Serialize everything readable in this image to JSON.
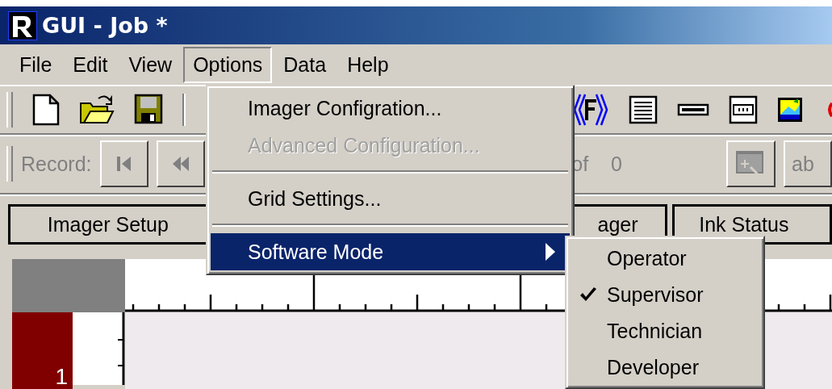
{
  "window": {
    "title": "GUI - Job *"
  },
  "menu_bar": [
    {
      "label": "File",
      "selected": false
    },
    {
      "label": "Edit",
      "selected": false
    },
    {
      "label": "View",
      "selected": false
    },
    {
      "label": "Options",
      "selected": true
    },
    {
      "label": "Data",
      "selected": false
    },
    {
      "label": "Help",
      "selected": false
    }
  ],
  "options_menu": {
    "items": [
      {
        "kind": "item",
        "label": "Imager Configration...",
        "disabled": false,
        "selected": false
      },
      {
        "kind": "item",
        "label": "Advanced Configuration...",
        "disabled": true,
        "selected": false
      },
      {
        "kind": "separator"
      },
      {
        "kind": "item",
        "label": "Grid Settings...",
        "disabled": false,
        "selected": false
      },
      {
        "kind": "separator"
      },
      {
        "kind": "submenu",
        "label": "Software Mode",
        "disabled": false,
        "selected": true
      }
    ]
  },
  "software_mode_menu": {
    "items": [
      {
        "label": "Operator",
        "checked": false
      },
      {
        "label": "Supervisor",
        "checked": true
      },
      {
        "label": "Technician",
        "checked": false
      },
      {
        "label": "Developer",
        "checked": false
      }
    ]
  },
  "record_bar": {
    "label": "Record:",
    "of": "of",
    "total": "0",
    "button_text": "ab"
  },
  "tabs": [
    {
      "label": "Imager Setup"
    },
    {
      "label": "ager"
    },
    {
      "label": "Ink Status"
    }
  ],
  "grid": {
    "row_label": "1"
  }
}
